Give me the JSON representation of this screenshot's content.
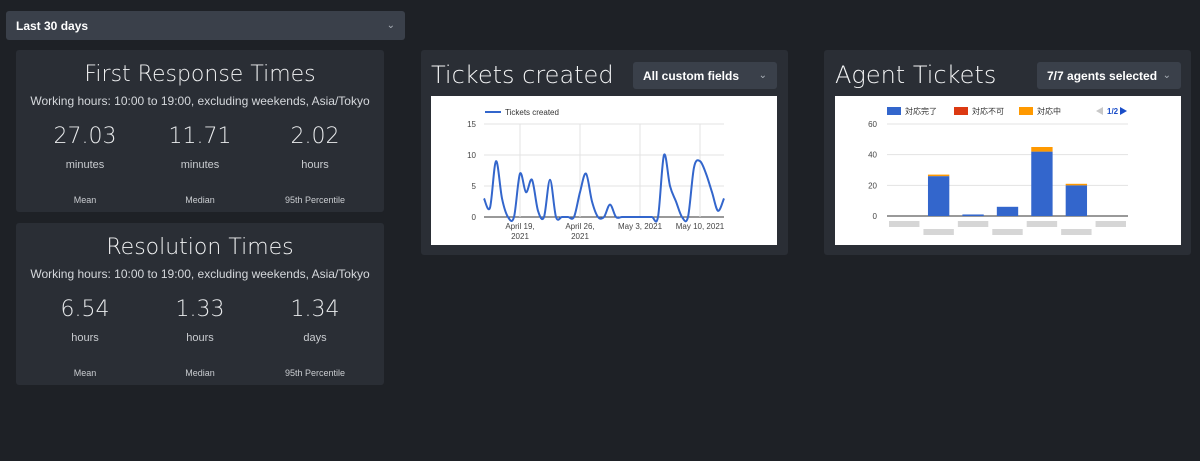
{
  "range_select": {
    "label": "Last 30 days"
  },
  "first_response": {
    "title": "First Response Times",
    "subtitle": "Working hours: 10:00 to 19:00, excluding weekends, Asia/Tokyo",
    "stats": [
      {
        "value": "27.03",
        "unit": "minutes",
        "label": "Mean"
      },
      {
        "value": "11.71",
        "unit": "minutes",
        "label": "Median"
      },
      {
        "value": "2.02",
        "unit": "hours",
        "label": "95th Percentile"
      }
    ]
  },
  "resolution": {
    "title": "Resolution Times",
    "subtitle": "Working hours: 10:00 to 19:00, excluding weekends, Asia/Tokyo",
    "stats": [
      {
        "value": "6.54",
        "unit": "hours",
        "label": "Mean"
      },
      {
        "value": "1.33",
        "unit": "hours",
        "label": "Median"
      },
      {
        "value": "1.34",
        "unit": "days",
        "label": "95th Percentile"
      }
    ]
  },
  "tickets_created": {
    "title": "Tickets created",
    "filter_label": "All custom fields"
  },
  "agent_tickets": {
    "title": "Agent Tickets",
    "filter_label": "7/7 agents selected",
    "pager": "1/2"
  },
  "icons": {
    "dropdown": "chevron-down-icon",
    "prev": "triangle-left-icon",
    "next": "triangle-right-icon"
  },
  "colors": {
    "line": "#3366cc",
    "done": "#3366cc",
    "unable": "#dc3912",
    "in_progress": "#ff9900"
  },
  "chart_data": [
    {
      "type": "line",
      "legend": [
        "Tickets created"
      ],
      "series": [
        {
          "name": "Tickets created",
          "x": [
            0,
            1,
            2,
            3,
            4,
            5,
            6,
            7,
            8,
            9,
            10,
            11,
            12,
            13,
            14,
            15,
            16,
            17,
            18,
            19,
            20,
            21,
            22,
            23,
            24,
            25,
            26,
            27,
            28,
            29,
            30,
            31,
            32,
            33,
            34,
            35,
            36,
            37,
            38,
            39,
            40
          ],
          "y": [
            3,
            1.5,
            9,
            3,
            0,
            0,
            7,
            4,
            6,
            1,
            0,
            6,
            0,
            0,
            0,
            0,
            4,
            7,
            2.5,
            0,
            0,
            2,
            0,
            0,
            0,
            0,
            0,
            0,
            0,
            0,
            10,
            5,
            2.5,
            0,
            0,
            8,
            9,
            7,
            4,
            1,
            3
          ]
        }
      ],
      "x_ticks": [
        {
          "x": 6,
          "line1": "April 19,",
          "line2": "2021"
        },
        {
          "x": 16,
          "line1": "April 26,",
          "line2": "2021"
        },
        {
          "x": 26,
          "line1": "May 3, 2021",
          "line2": ""
        },
        {
          "x": 36,
          "line1": "May 10, 2021",
          "line2": ""
        }
      ],
      "ylim": [
        0,
        15
      ],
      "y_ticks": [
        0,
        5,
        10,
        15
      ],
      "grid": true,
      "legend_position": "top-left"
    },
    {
      "type": "bar",
      "stacked": true,
      "legend": [
        "対応完了",
        "対応不可",
        "対応中"
      ],
      "series": [
        {
          "name": "対応完了",
          "values": [
            0,
            26,
            1,
            6,
            42,
            20,
            0
          ]
        },
        {
          "name": "対応不可",
          "values": [
            0,
            0,
            0,
            0,
            0,
            0,
            0
          ]
        },
        {
          "name": "対応中",
          "values": [
            0,
            1,
            0,
            0,
            3,
            1,
            0
          ]
        }
      ],
      "ylim": [
        0,
        60
      ],
      "y_ticks": [
        0,
        20,
        40,
        60
      ],
      "grid": true,
      "legend_position": "top",
      "pager": "1/2"
    }
  ]
}
